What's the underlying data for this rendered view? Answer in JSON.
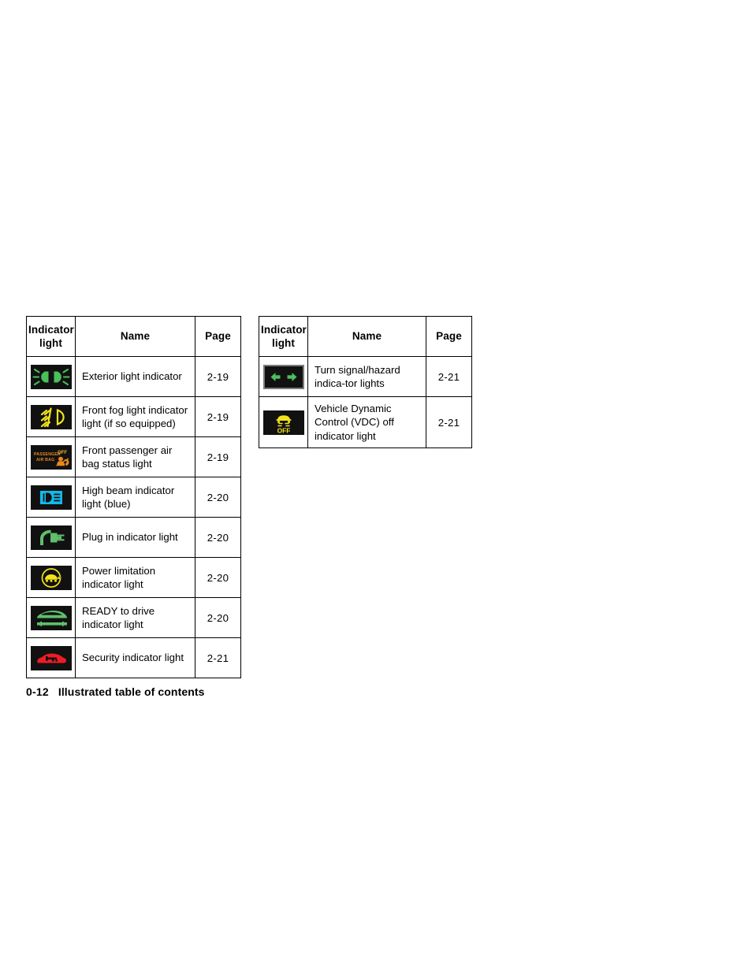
{
  "document": {
    "page_number": "0-12",
    "footer_title": "Illustrated table of contents"
  },
  "colors": {
    "tile_background": "#111111",
    "green": "#5fbf6a",
    "green_dark": "#3fae52",
    "yellow": "#f2e31a",
    "amber": "#e8891f",
    "blue": "#13b9ea",
    "red": "#ee1c24",
    "tile_frame": "#7a7a7a"
  },
  "tables": [
    {
      "id": "left-table",
      "columns": [
        "Indicator light",
        "Name",
        "Page"
      ],
      "column_labels": {
        "icon_line1": "Indicator",
        "icon_line2": "light",
        "name": "Name",
        "page": "Page"
      },
      "rows": [
        {
          "icon": "exterior-light-indicator-icon",
          "name": "Exterior light indicator",
          "page": "2-19"
        },
        {
          "icon": "front-fog-light-indicator-icon",
          "name": "Front fog light indicator light (if so equipped)",
          "page": "2-19"
        },
        {
          "icon": "front-passenger-air-bag-status-icon",
          "name": "Front passenger air bag status light",
          "page": "2-19"
        },
        {
          "icon": "high-beam-indicator-icon",
          "name": "High beam indicator light (blue)",
          "page": "2-20"
        },
        {
          "icon": "plug-in-indicator-icon",
          "name": "Plug in indicator light",
          "page": "2-20"
        },
        {
          "icon": "power-limitation-indicator-icon",
          "name": "Power limitation indicator light",
          "page": "2-20"
        },
        {
          "icon": "ready-to-drive-indicator-icon",
          "name": "READY to drive indicator light",
          "page": "2-20"
        },
        {
          "icon": "security-indicator-icon",
          "name": "Security indicator light",
          "page": "2-21"
        }
      ]
    },
    {
      "id": "right-table",
      "columns": [
        "Indicator light",
        "Name",
        "Page"
      ],
      "column_labels": {
        "icon_line1": "Indicator",
        "icon_line2": "light",
        "name": "Name",
        "page": "Page"
      },
      "rows": [
        {
          "icon": "turn-signal-hazard-indicator-icon",
          "name": "Turn signal/hazard indica-tor lights",
          "page": "2-21"
        },
        {
          "icon": "vdc-off-indicator-icon",
          "name": "Vehicle Dynamic Control (VDC) off indicator light",
          "page": "2-21"
        }
      ]
    }
  ],
  "icon_labels": {
    "air_bag_line1": "PASSENGER",
    "air_bag_line2": "AIR BAG",
    "air_bag_off": "OFF",
    "vdc_off": "OFF"
  }
}
